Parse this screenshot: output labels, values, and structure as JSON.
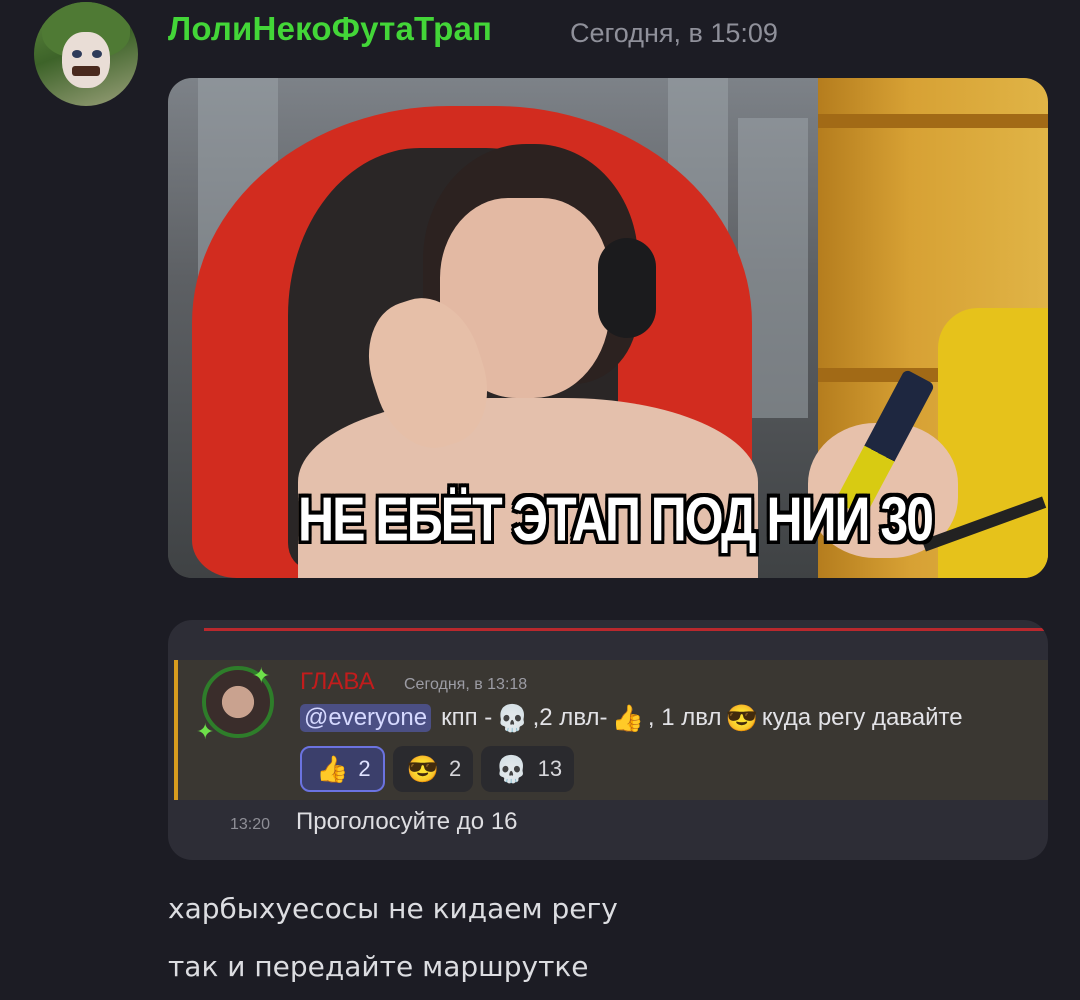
{
  "message": {
    "author": "ЛолиНекоФутаТрап",
    "timestamp": "Сегодня, в 15:09",
    "author_color": "#43d638",
    "meme_caption": "НЕ ЕБЁТ ЭТАП ПОД НИИ 30"
  },
  "embed": {
    "author": "ГЛАВА",
    "author_color": "#c21c1c",
    "timestamp": "Сегодня, в 13:18",
    "mention": "@everyone",
    "body_parts": [
      "кпп -",
      ",2 лвл-",
      ", 1 лвл",
      " куда регу давайте"
    ],
    "body_icons": [
      "skull-emoji",
      "thumbs-up-emoji",
      "sunglasses-emoji"
    ],
    "reactions": [
      {
        "icon": "thumbs-up-emoji",
        "count": "2",
        "active": true
      },
      {
        "icon": "sunglasses-emoji",
        "count": "2",
        "active": false
      },
      {
        "icon": "skull-emoji",
        "count": "13",
        "active": false
      }
    ],
    "reply_time": "13:20",
    "reply_text": "Проголосуйте до 16"
  },
  "lines": [
    "харбыхуесосы не кидаем регу",
    "так и передайте маршрутке"
  ]
}
